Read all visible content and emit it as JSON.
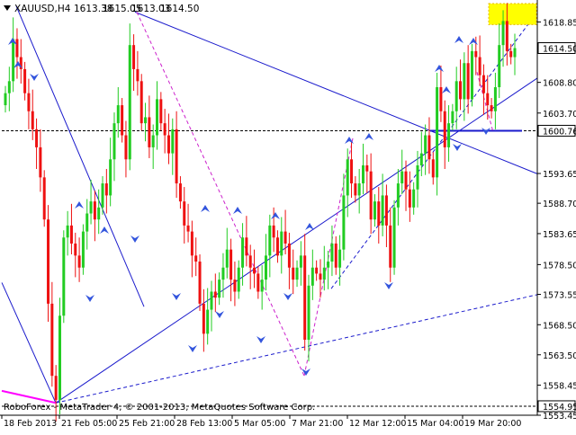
{
  "chart_data": {
    "type": "candlestick",
    "symbol_line": "XAUUSD,H4",
    "ohlc_header": [
      "1613.38",
      "1615.05",
      "1613.03",
      "1614.50"
    ],
    "footer": "RoboForex - MetaTrader 4, © 2001-2013, MetaQuotes Software Corp.",
    "price_ticks": [
      "1618.85",
      "1614.50",
      "1608.80",
      "1603.70",
      "1600.76",
      "1593.65",
      "1588.70",
      "1583.65",
      "1578.50",
      "1573.55",
      "1568.50",
      "1563.50",
      "1558.45",
      "1554.95",
      "1553.45"
    ],
    "current_price": "1614.50",
    "level_price": "1600.76",
    "low_price": "1554.95",
    "x_ticks": [
      "18 Feb 2013",
      "21 Feb 05:00",
      "25 Feb 21:00",
      "28 Feb 13:00",
      "5 Mar 05:00",
      "7 Mar 21:00",
      "12 Mar 12:00",
      "15 Mar 04:00",
      "19 Mar 20:00"
    ],
    "ylim": [
      1553.45,
      1621.9
    ],
    "close_series": [
      1607,
      1609,
      1616,
      1613,
      1611,
      1607,
      1604,
      1601,
      1598,
      1593,
      1586,
      1572,
      1560,
      1556,
      1570,
      1583,
      1585,
      1582,
      1580,
      1578,
      1584,
      1587,
      1589,
      1586,
      1588,
      1592,
      1590,
      1596,
      1602,
      1605,
      1600,
      1596,
      1615,
      1611,
      1609,
      1602,
      1603,
      1598,
      1600,
      1606,
      1602,
      1600,
      1597,
      1601,
      1592,
      1589,
      1585,
      1584,
      1580,
      1579,
      1572,
      1567,
      1571,
      1574,
      1573,
      1576,
      1578,
      1581,
      1576,
      1574,
      1578,
      1583,
      1580,
      1578,
      1577,
      1574,
      1576,
      1580,
      1585,
      1583,
      1580,
      1584,
      1582,
      1578,
      1576,
      1578,
      1580,
      1566,
      1575,
      1578,
      1577,
      1576,
      1578,
      1579,
      1582,
      1578,
      1581,
      1590,
      1596,
      1592,
      1590,
      1592,
      1595,
      1594,
      1586,
      1589,
      1585,
      1590,
      1585,
      1578,
      1588,
      1592,
      1594,
      1591,
      1588,
      1591,
      1595,
      1597,
      1600,
      1596,
      1593,
      1608,
      1604,
      1598,
      1602,
      1604,
      1609,
      1606,
      1612,
      1606,
      1614,
      1613,
      1610,
      1607,
      1605,
      1604,
      1608,
      1615,
      1619,
      1614,
      1613,
      1614.5
    ],
    "level_lines": [
      1600.76,
      1554.95
    ]
  }
}
